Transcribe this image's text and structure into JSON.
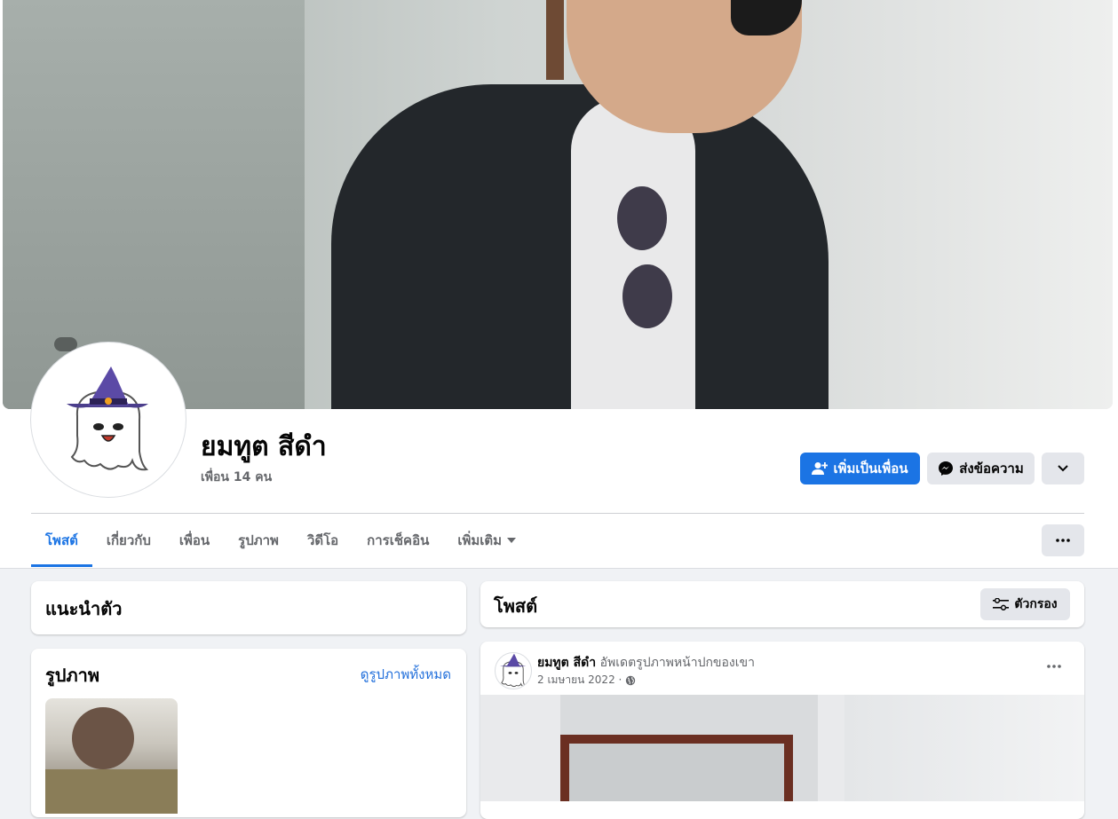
{
  "profile": {
    "name": "ยมทูต สีดำ",
    "friends_count": "เพื่อน 14 คน"
  },
  "actions": {
    "add_friend": "เพิ่มเป็นเพื่อน",
    "message": "ส่งข้อความ"
  },
  "tabs": [
    {
      "label": "โพสต์",
      "active": true
    },
    {
      "label": "เกี่ยวกับ"
    },
    {
      "label": "เพื่อน"
    },
    {
      "label": "รูปภาพ"
    },
    {
      "label": "วิดีโอ"
    },
    {
      "label": "การเช็คอิน"
    },
    {
      "label": "เพิ่มเติม"
    }
  ],
  "intro": {
    "title": "แนะนำตัว"
  },
  "photos": {
    "title": "รูปภาพ",
    "see_all": "ดูรูปภาพทั้งหมด"
  },
  "posts": {
    "title": "โพสต์",
    "filter_label": "ตัวกรอง"
  },
  "post": {
    "author": "ยมทูต สีดำ",
    "action": "อัพเดตรูปภาพหน้าปกของเขา",
    "date": "2 เมษายน 2022 ·"
  },
  "colors": {
    "accent": "#1b74e4",
    "background": "#f0f2f5"
  },
  "icons": [
    "add-friend-icon",
    "messenger-icon",
    "chevron-down-icon",
    "more-icon",
    "filter-icon",
    "globe-icon",
    "ghost-avatar-icon"
  ]
}
